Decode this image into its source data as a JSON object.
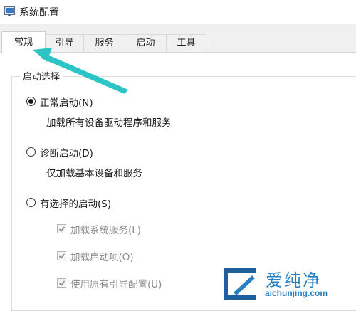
{
  "window": {
    "title": "系统配置"
  },
  "tabs": [
    {
      "label": "常规",
      "active": true
    },
    {
      "label": "引导",
      "active": false
    },
    {
      "label": "服务",
      "active": false
    },
    {
      "label": "启动",
      "active": false
    },
    {
      "label": "工具",
      "active": false
    }
  ],
  "startup_selection": {
    "group_title": "启动选择",
    "options": [
      {
        "label": "正常启动(N)",
        "description": "加载所有设备驱动程序和服务",
        "selected": true
      },
      {
        "label": "诊断启动(D)",
        "description": "仅加载基本设备和服务",
        "selected": false
      },
      {
        "label": "有选择的启动(S)",
        "description": "",
        "selected": false
      }
    ],
    "selective_items": [
      {
        "label": "加载系统服务(L)",
        "checked": true,
        "enabled": false
      },
      {
        "label": "加载启动项(O)",
        "checked": true,
        "enabled": false
      },
      {
        "label": "使用原有引导配置(U)",
        "checked": true,
        "enabled": false
      }
    ]
  },
  "watermark": {
    "text": "爱纯净",
    "url": "aichunjing.com"
  },
  "colors": {
    "arrow": "#2ec4c6",
    "watermark": "#2a7fc0"
  },
  "icons": [
    "system-config-app-icon",
    "annotation-arrow",
    "watermark-logo-icon"
  ]
}
